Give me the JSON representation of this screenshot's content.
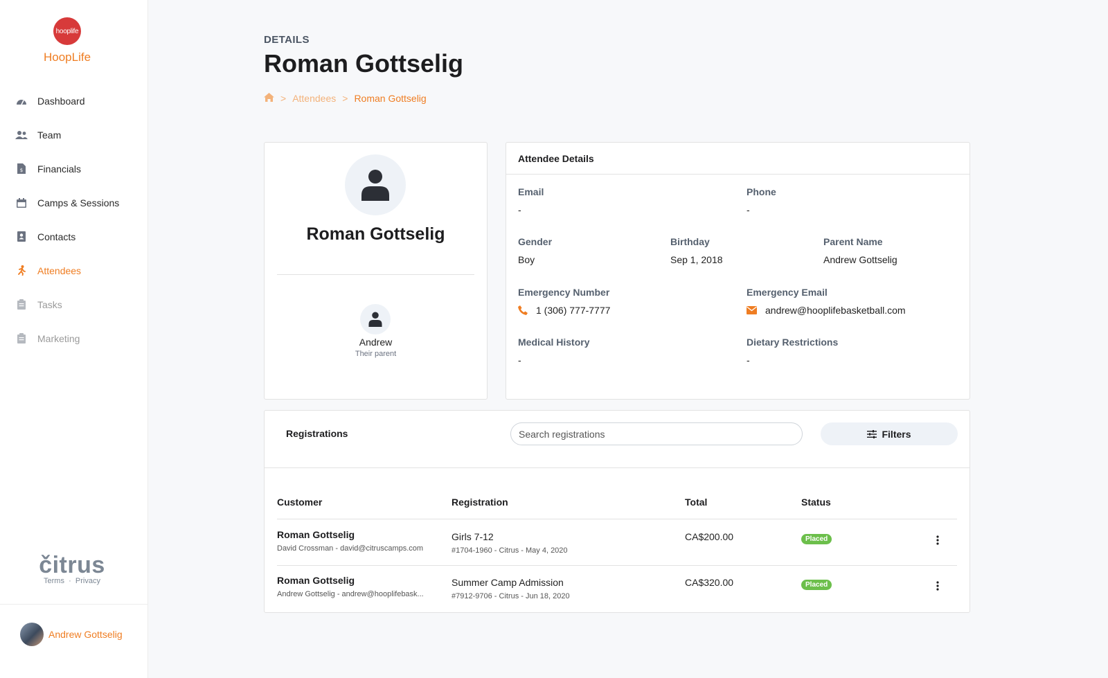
{
  "brand": {
    "logo_mark": "hooplife",
    "name": "HoopLife",
    "accent": "#ef7d22"
  },
  "sidebar": {
    "items": [
      {
        "label": "Dashboard",
        "icon": "gauge-icon"
      },
      {
        "label": "Team",
        "icon": "users-icon"
      },
      {
        "label": "Financials",
        "icon": "receipt-icon"
      },
      {
        "label": "Camps & Sessions",
        "icon": "calendar-icon"
      },
      {
        "label": "Contacts",
        "icon": "address-book-icon"
      },
      {
        "label": "Attendees",
        "icon": "running-icon"
      },
      {
        "label": "Tasks",
        "icon": "clipboard-icon"
      },
      {
        "label": "Marketing",
        "icon": "clipboard-icon"
      }
    ],
    "active": "Attendees",
    "footer": {
      "brand": "čitrus",
      "terms": "Terms",
      "dot": "·",
      "privacy": "Privacy"
    },
    "user": {
      "name": "Andrew Gottselig"
    }
  },
  "header": {
    "eyebrow": "DETAILS",
    "title": "Roman Gottselig",
    "breadcrumb": {
      "sep": ">",
      "parent": "Attendees",
      "current": "Roman Gottselig"
    }
  },
  "profile": {
    "name": "Roman Gottselig",
    "parent": {
      "name": "Andrew",
      "relation": "Their parent"
    }
  },
  "details": {
    "title": "Attendee Details",
    "email": {
      "label": "Email",
      "value": "-"
    },
    "phone": {
      "label": "Phone",
      "value": "-"
    },
    "gender": {
      "label": "Gender",
      "value": "Boy"
    },
    "birthday": {
      "label": "Birthday",
      "value": "Sep 1, 2018"
    },
    "parent_name": {
      "label": "Parent Name",
      "value": "Andrew Gottselig"
    },
    "emergency_number": {
      "label": "Emergency Number",
      "value": "1 (306) 777-7777"
    },
    "emergency_email": {
      "label": "Emergency Email",
      "value": "andrew@hooplifebasketball.com"
    },
    "medical_history": {
      "label": "Medical History",
      "value": "-"
    },
    "dietary": {
      "label": "Dietary Restrictions",
      "value": "-"
    }
  },
  "registrations": {
    "title": "Registrations",
    "search_placeholder": "Search registrations",
    "filters_label": "Filters",
    "columns": [
      "Customer",
      "Registration",
      "Total",
      "Status"
    ],
    "rows": [
      {
        "customer": "Roman Gottselig",
        "contact": "David Crossman - david@citruscamps.com",
        "registration": "Girls 7-12",
        "meta": "#1704-1960 - Citrus - May 4, 2020",
        "total": "CA$200.00",
        "status": "Placed"
      },
      {
        "customer": "Roman Gottselig",
        "contact": "Andrew Gottselig - andrew@hooplifebask...",
        "registration": "Summer Camp Admission",
        "meta": "#7912-9706 - Citrus - Jun 18, 2020",
        "total": "CA$320.00",
        "status": "Placed"
      }
    ]
  },
  "colors": {
    "accent": "#ef7d22",
    "badge_placed": "#6cbf4b",
    "logo_red": "#d73a3a"
  }
}
